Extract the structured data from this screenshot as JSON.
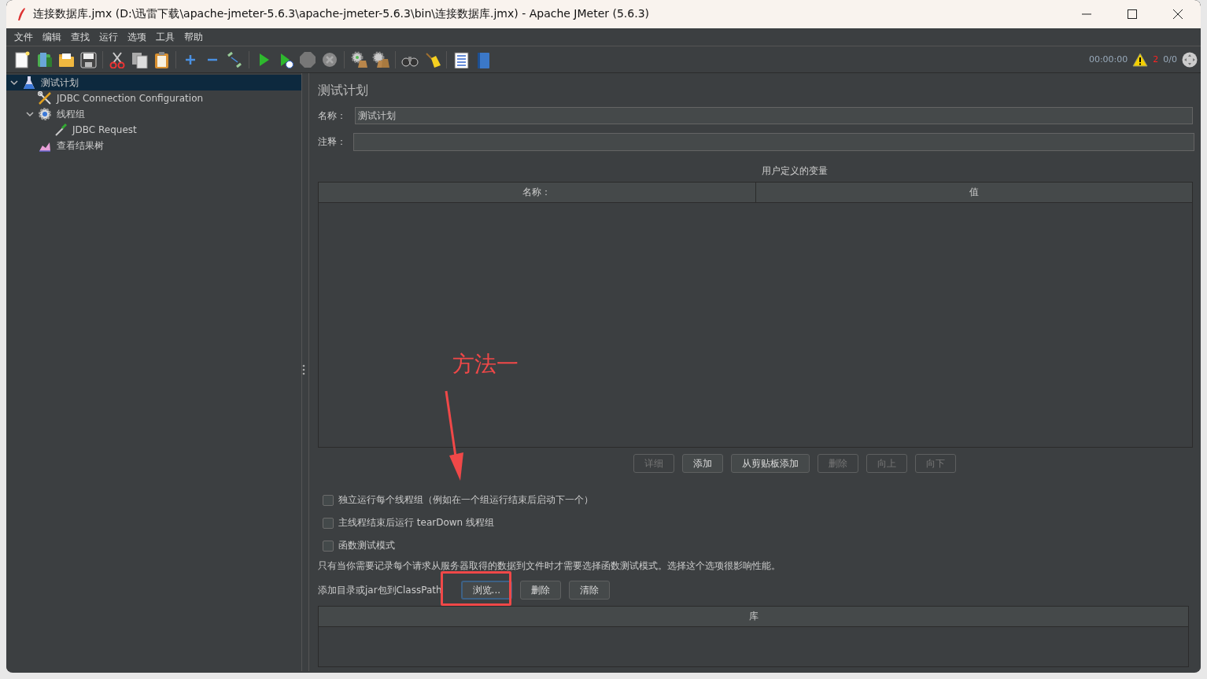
{
  "window": {
    "title": "连接数据库.jmx (D:\\迅雷下载\\apache-jmeter-5.6.3\\apache-jmeter-5.6.3\\bin\\连接数据库.jmx) - Apache JMeter (5.6.3)"
  },
  "menu": [
    "文件",
    "编辑",
    "查找",
    "运行",
    "选项",
    "工具",
    "帮助"
  ],
  "status": {
    "elapsed": "00:00:00",
    "error_count": "2",
    "threads": "0/0"
  },
  "tree": [
    {
      "label": "测试计划",
      "kind": "plan",
      "selected": true,
      "expanded": true,
      "children": [
        {
          "label": "JDBC Connection Configuration",
          "kind": "config",
          "selected": false
        },
        {
          "label": "线程组",
          "kind": "threadgroup",
          "selected": false,
          "expanded": true,
          "children": [
            {
              "label": "JDBC Request",
              "kind": "sampler",
              "selected": false
            }
          ]
        },
        {
          "label": "查看结果树",
          "kind": "listener",
          "selected": false
        }
      ]
    }
  ],
  "panel": {
    "title": "测试计划",
    "name_label": "名称：",
    "name_value": "测试计划",
    "comment_label": "注释：",
    "variables": {
      "title": "用户定义的变量",
      "columns": [
        "名称：",
        "值"
      ]
    },
    "buttons": [
      {
        "label": "详细",
        "disabled": true
      },
      {
        "label": "添加",
        "disabled": false
      },
      {
        "label": "从剪贴板添加",
        "disabled": false
      },
      {
        "label": "删除",
        "disabled": true
      },
      {
        "label": "向上",
        "disabled": true
      },
      {
        "label": "向下",
        "disabled": true
      }
    ],
    "options": [
      {
        "label": "独立运行每个线程组（例如在一个组运行结束后启动下一个）",
        "checked": false
      },
      {
        "label": "主线程结束后运行 tearDown 线程组",
        "checked": false
      },
      {
        "label": "函数测试模式",
        "checked": false
      }
    ],
    "hint": "只有当你需要记录每个请求从服务器取得的数据到文件时才需要选择函数测试模式。选择这个选项很影响性能。",
    "classpath": {
      "label": "添加目录或jar包到ClassPath",
      "buttons": [
        {
          "label": "浏览...",
          "focused": true
        },
        {
          "label": "删除",
          "focused": false
        },
        {
          "label": "清除",
          "focused": false
        }
      ],
      "columns": [
        "库"
      ]
    }
  },
  "annotation": {
    "text": "方法一"
  }
}
